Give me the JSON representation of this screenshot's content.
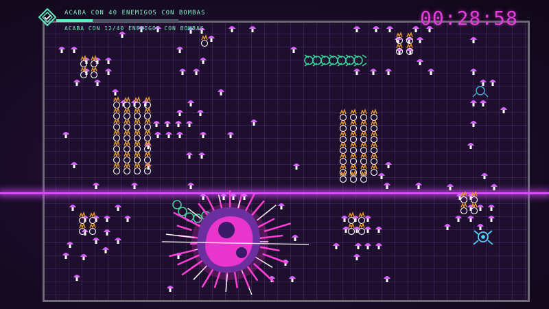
{
  "hud": {
    "objective_title": "ACABA CON 40 ENEMIGOS CON BOMBAS",
    "progress_text": "ACABA CON 12/40 ENEMIGOS CON BOMBAS",
    "progress_current": 12,
    "progress_total": 40,
    "timer": "00:28:58",
    "emblem_icon": "shield-check-icon"
  },
  "colors": {
    "accent_green": "#5ff0c2",
    "timer_magenta": "#e23ed8",
    "mushroom_pink": "#d862ff",
    "flower_orange": "#e69a2e",
    "centipede_green": "#3ed39b",
    "player_cyan": "#5ad0ff",
    "laser": "#d94dff",
    "explosion": "#ff3fd6"
  },
  "scene": {
    "arena_icon": "grid-arena",
    "mushroom_icon": "mushroom-icon",
    "flower_icon": "flower-icon",
    "centipede_icon": "centipede-icon",
    "player_icon": "spider-ship-icon",
    "explosion_icon": "bomb-explosion-icon",
    "laser_icon": "laser-barrier-icon"
  }
}
